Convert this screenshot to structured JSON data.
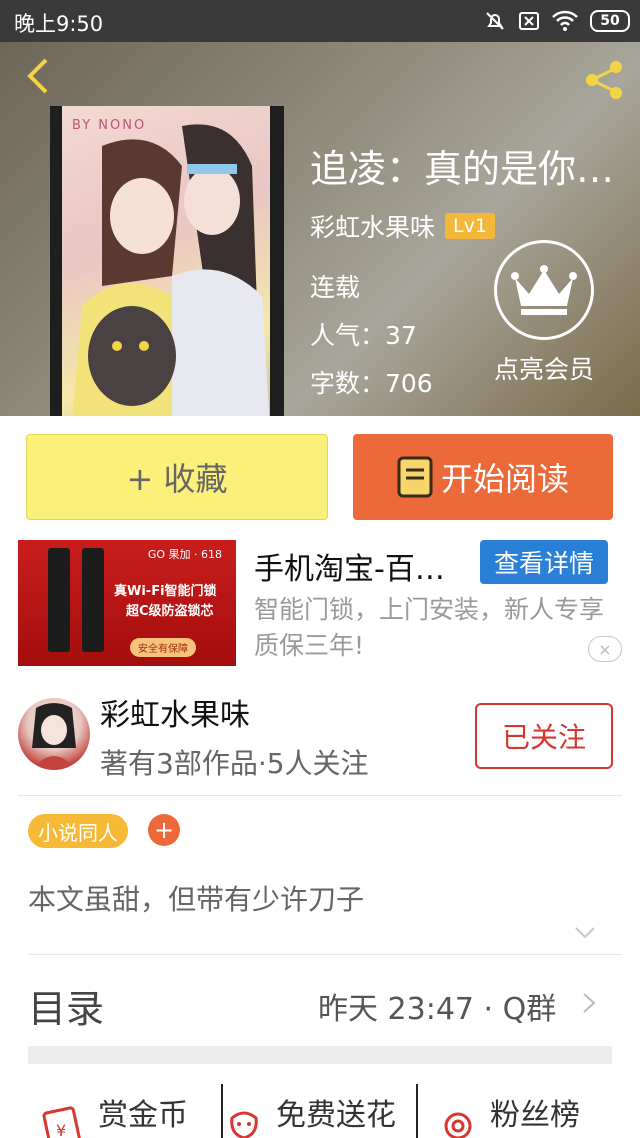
{
  "status_bar": {
    "time": "晚上9:50",
    "battery": "50"
  },
  "header": {
    "cover_text": "BY NONO",
    "title": "追凌：真的是你…",
    "author": "彩虹水果味",
    "level": "Lv1",
    "status": "连载",
    "popularity": "人气：37",
    "word_count": "字数：706",
    "vip_label": "点亮会员"
  },
  "actions": {
    "favorite": "+ 收藏",
    "read": "开始阅读"
  },
  "ad": {
    "title": "手机淘宝-百…",
    "button": "查看详情",
    "description": "智能门锁，上门安装，新人专享质保三年!",
    "image_brand": "GO 果加 · 618",
    "image_line1": "真Wi-Fi智能门锁",
    "image_line2": "超C级防盗锁芯",
    "image_badge": "安全有保障",
    "close": "×"
  },
  "author_card": {
    "name": "彩虹水果味",
    "stats": "著有3部作品·5人关注",
    "follow_button": "已关注"
  },
  "tags": {
    "tag1": "小说同人",
    "add": "+"
  },
  "synopsis": "本文虽甜，但带有少许刀子",
  "toc": {
    "label": "目录",
    "update": "昨天 23:47 · Q群"
  },
  "bottom_bar": {
    "reward": "赏金币",
    "flower": "免费送花",
    "fans": "粉丝榜"
  },
  "colors": {
    "accent_orange": "#ec6a3a",
    "fav_yellow": "#fbf17a",
    "tag_yellow": "#f5b936",
    "follow_red": "#d9362f",
    "ad_blue": "#2a7fd6"
  }
}
